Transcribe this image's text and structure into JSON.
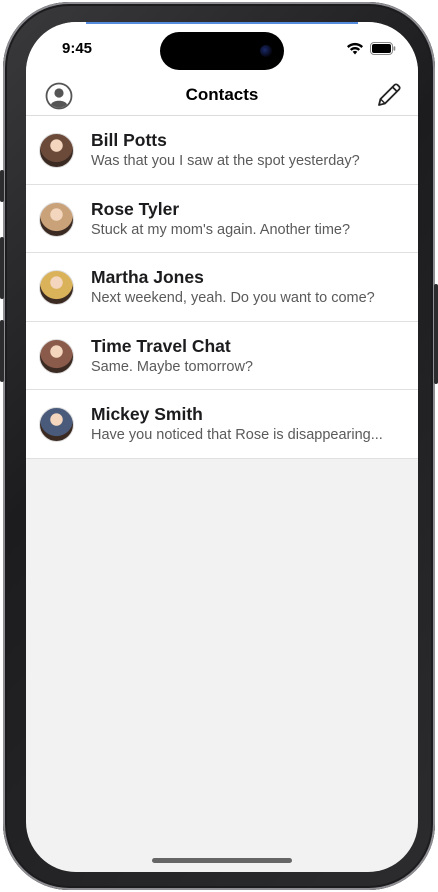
{
  "status_bar": {
    "time": "9:45",
    "icons": [
      "wifi-icon",
      "battery-icon"
    ]
  },
  "nav": {
    "title": "Contacts",
    "left_icon": "profile-icon",
    "right_icon": "compose-icon"
  },
  "contacts": [
    {
      "name": "Bill Potts",
      "message": "Was that you I saw at the spot yesterday?",
      "avatar_color": "#6b4a3a"
    },
    {
      "name": "Rose Tyler",
      "message": "Stuck at my mom's again. Another time?",
      "avatar_color": "#c9a27a"
    },
    {
      "name": "Martha Jones",
      "message": "Next weekend, yeah. Do you want to come?",
      "avatar_color": "#d9b25a"
    },
    {
      "name": "Time Travel Chat",
      "message": "Same. Maybe tomorrow?",
      "avatar_color": "#8a5a4a"
    },
    {
      "name": "Mickey Smith",
      "message": "Have you noticed that Rose is disappearing...",
      "avatar_color": "#4a5a7a"
    }
  ],
  "colors": {
    "background": "#f2f2f2",
    "row_background": "#ffffff",
    "separator": "#e0e0e0"
  }
}
